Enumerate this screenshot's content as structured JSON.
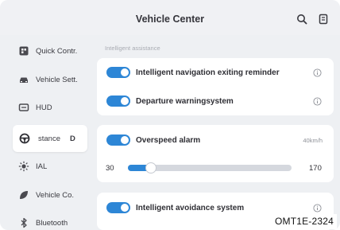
{
  "header": {
    "title": "Vehicle Center",
    "icons": [
      "search-icon",
      "manual-icon"
    ]
  },
  "sidebar": {
    "items": [
      {
        "label": "Quick Contr.",
        "icon": "quick-control-icon"
      },
      {
        "label": "Vehicle Sett.",
        "icon": "car-icon"
      },
      {
        "label": "HUD",
        "icon": "hud-icon"
      },
      {
        "label": "stance",
        "extra": "D",
        "icon": "steering-wheel-icon",
        "active": true
      },
      {
        "label": "IAL",
        "icon": "headlight-icon"
      },
      {
        "label": "Vehicle Co.",
        "icon": "leaf-icon"
      },
      {
        "label": "Bluetooth",
        "icon": "bluetooth-icon"
      }
    ]
  },
  "main": {
    "section_label": "Intelligent assistance",
    "settings": {
      "nav_exit": {
        "label": "Intelligent navigation exiting reminder",
        "on": true
      },
      "departure": {
        "label": "Departure warningsystem",
        "on": true
      },
      "overspeed": {
        "label": "Overspeed alarm",
        "on": true,
        "value_text": "40km/h",
        "slider": {
          "min": "30",
          "max": "170",
          "value": 40
        }
      },
      "avoidance": {
        "label": "Intelligent avoidance system",
        "on": true
      }
    }
  },
  "watermark": "OMT1E-2324",
  "colors": {
    "accent": "#2d86d6",
    "background": "#eef0f3",
    "card": "#ffffff"
  }
}
